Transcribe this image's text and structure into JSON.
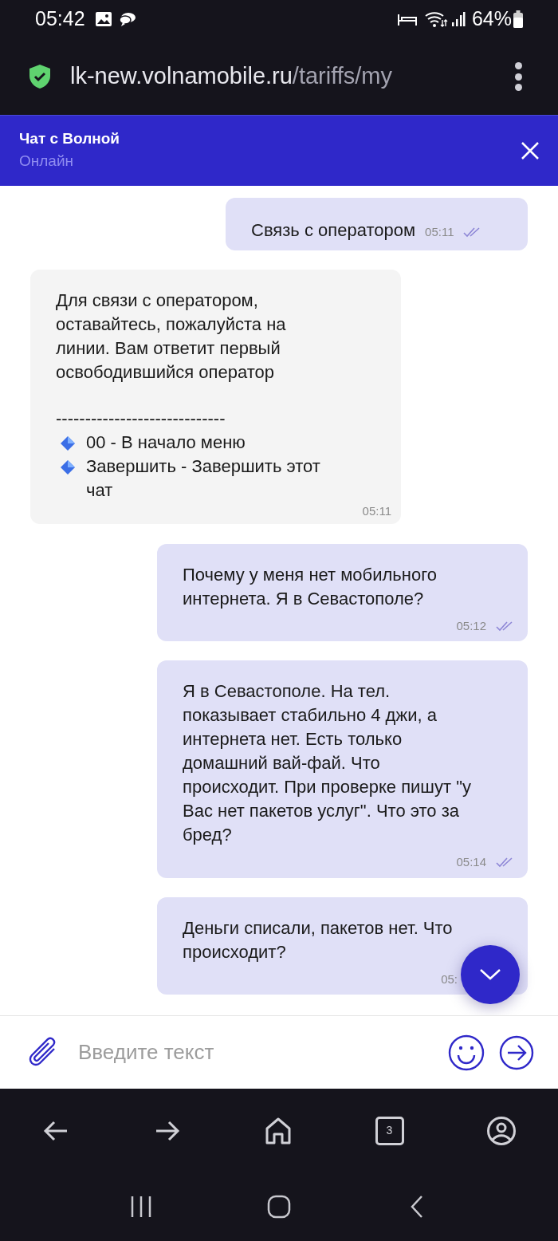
{
  "status_bar": {
    "time": "05:42",
    "battery": "64%"
  },
  "browser": {
    "url_host": "lk-new.volnamobile.ru",
    "url_path": "/tariffs/my",
    "tab_count": "3"
  },
  "chat_header": {
    "title": "Чат с Волной",
    "status": "Онлайн"
  },
  "messages": [
    {
      "kind": "outgoing",
      "text": "Связь с оператором",
      "time": "05:11",
      "read": true
    },
    {
      "kind": "incoming",
      "text": "Для связи с оператором, оставайтесь, пожалуйста на линии. Вам ответит первый освободившийся оператор",
      "divider": "-----------------------------",
      "options": [
        "00 - В начало меню",
        "Завершить - Завершить этот чат"
      ],
      "time": "05:11"
    },
    {
      "kind": "outgoing",
      "text": "Почему у меня нет мобильного интернета. Я в Севастополе?",
      "time": "05:12",
      "read": true
    },
    {
      "kind": "outgoing",
      "text": "Я в Севастополе. На тел. показывает стабильно 4 джи, а интернета нет. Есть только домашний вай-фай. Что происходит. При проверке пишут \"у Вас нет пакетов услуг\". Что это за бред?",
      "time": "05:14",
      "read": true
    },
    {
      "kind": "outgoing",
      "text": "Деньги списали, пакетов нет. Что происходит?",
      "time": "05:"
    }
  ],
  "composer": {
    "placeholder": "Введите текст"
  }
}
